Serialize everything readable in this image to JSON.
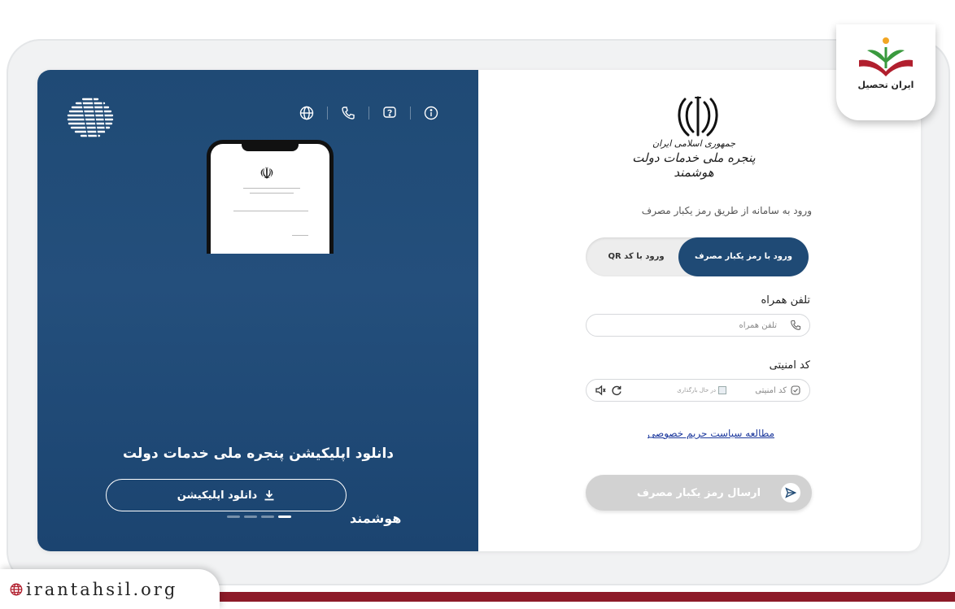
{
  "promo": {
    "title": "دانلود اپلیکیشن پنجره ملی خدمات دولت",
    "download_button": "دانلود اپلیکیشن",
    "subtitle_word": "هوشمند",
    "slider_dots": 4,
    "active_dot": 4,
    "top_icons": [
      "info-icon",
      "help-icon",
      "phone-icon",
      "globe-icon"
    ]
  },
  "login": {
    "brand_line1": "جمهوری اسلامی ایران",
    "brand_line2": "پنجره ملی خدمات دولت هوشمند",
    "subtitle": "ورود به سامانه از طریق رمز یکبار مصرف",
    "tabs": [
      {
        "label": "ورود با رمز یکبار مصرف",
        "active": true
      },
      {
        "label": "ورود با کد QR",
        "active": false
      }
    ],
    "phone": {
      "label": "تلفن همراه",
      "placeholder": "تلفن همراه"
    },
    "captcha": {
      "label": "کد امنیتی",
      "placeholder": "کد امنیتی",
      "image_alt": "در حال بارگذاری"
    },
    "privacy_link": "مطالعه سیاست حریم خصوصی",
    "send_button": "ارسال رمز یکبار مصرف"
  },
  "watermark": {
    "logo_text": "ایران تحصیل",
    "url": "irantahsil.org"
  },
  "colors": {
    "panel_blue": "#1f4a75",
    "stripe_red": "#8d1a28",
    "link_blue": "#1e3a9e"
  }
}
